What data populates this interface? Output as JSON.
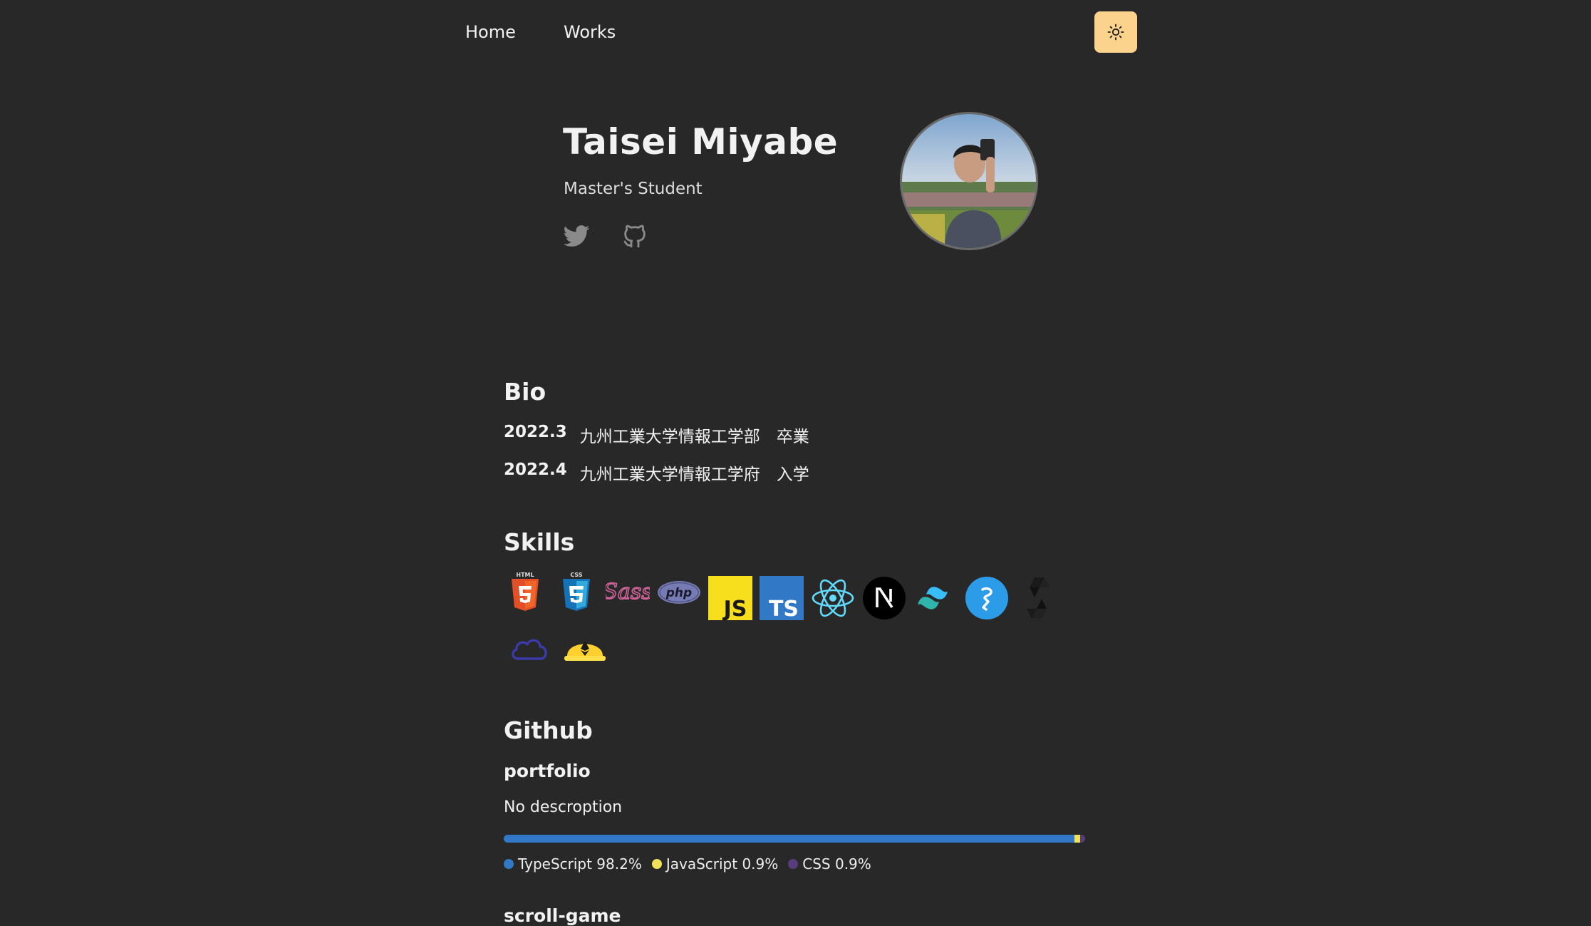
{
  "nav": {
    "home": "Home",
    "works": "Works"
  },
  "profile": {
    "name": "Taisei Miyabe",
    "role": "Master's Student"
  },
  "bio": {
    "title": "Bio",
    "items": [
      {
        "year": "2022.3",
        "text": "九州工業大学情報工学部　卒業"
      },
      {
        "year": "2022.4",
        "text": "九州工業大学情報工学府　入学"
      }
    ]
  },
  "skills": {
    "title": "Skills",
    "icons": [
      "html5-icon",
      "css3-icon",
      "sass-icon",
      "php-icon",
      "javascript-icon",
      "typescript-icon",
      "react-icon",
      "nextjs-icon",
      "tailwind-icon",
      "prisma-icon",
      "solidity-icon",
      "cloud-icon",
      "hardhat-icon"
    ],
    "php_text": "php",
    "js_text": "JS",
    "ts_text": "TS"
  },
  "github": {
    "title": "Github",
    "repos": [
      {
        "name": "portfolio",
        "description": "No descroption",
        "languages": [
          {
            "name": "TypeScript",
            "percent": 98.2,
            "label": "TypeScript 98.2%",
            "color": "#3178c6"
          },
          {
            "name": "JavaScript",
            "percent": 0.9,
            "label": "JavaScript 0.9%",
            "color": "#f1e05a"
          },
          {
            "name": "CSS",
            "percent": 0.9,
            "label": "CSS 0.9%",
            "color": "#563d7c"
          }
        ]
      },
      {
        "name": "scroll-game"
      }
    ]
  },
  "colors": {
    "background": "#282828",
    "theme_button": "#fbd38d"
  }
}
